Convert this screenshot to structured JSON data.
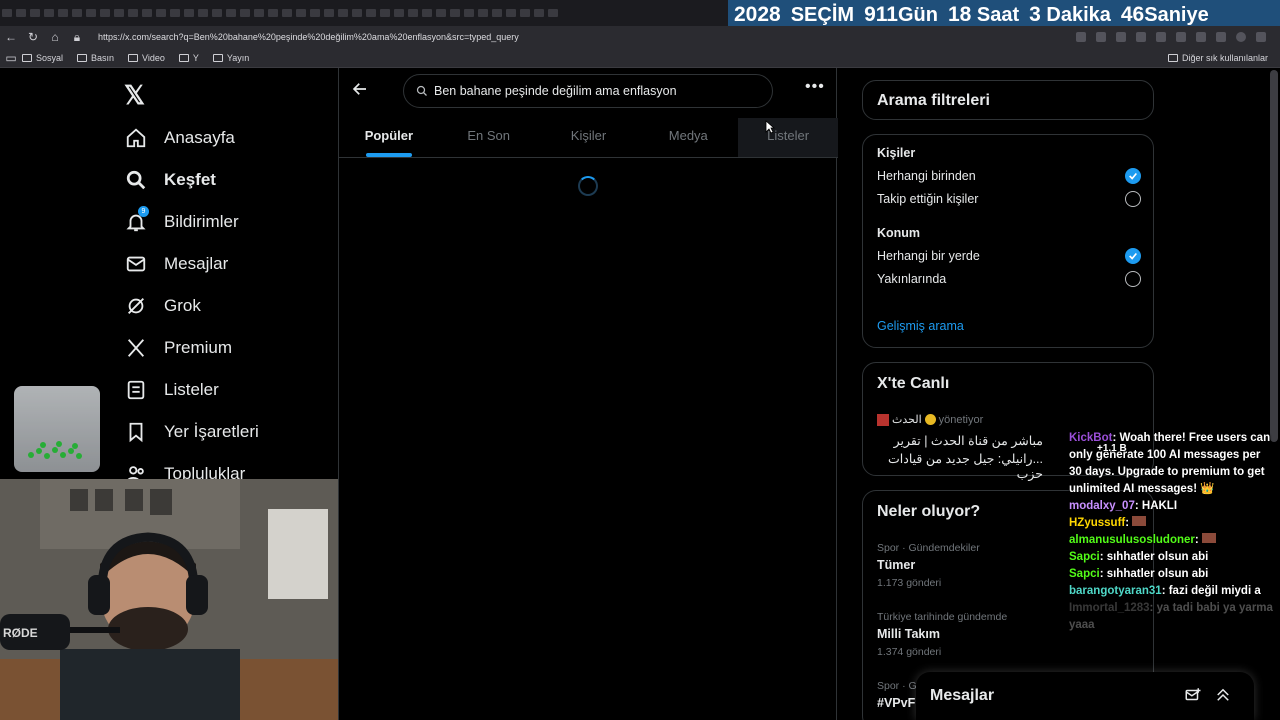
{
  "browser": {
    "url": "https://x.com/search?q=Ben%20bahane%20peşinde%20değilim%20ama%20enflasyon&src=typed_query",
    "bookmarks": [
      "Sosyal",
      "Basın",
      "Video",
      "Y",
      "Yayın"
    ],
    "other_bookmarks": "Diğer sık kullanılanlar"
  },
  "countdown": {
    "year": "2028",
    "label": "SEÇİM",
    "days_num": "911",
    "days_label": "Gün",
    "hours_num": "18",
    "hours_label": "Saat",
    "minutes_num": "3",
    "minutes_label": "Dakika",
    "seconds_num": "46",
    "seconds_label": "Saniye"
  },
  "nav": {
    "items": [
      {
        "label": "Anasayfa",
        "icon": "home-icon"
      },
      {
        "label": "Keşfet",
        "icon": "search-icon"
      },
      {
        "label": "Bildirimler",
        "icon": "bell-icon"
      },
      {
        "label": "Mesajlar",
        "icon": "mail-icon"
      },
      {
        "label": "Grok",
        "icon": "grok-icon"
      },
      {
        "label": "Premium",
        "icon": "x-icon"
      },
      {
        "label": "Listeler",
        "icon": "list-icon"
      },
      {
        "label": "Yer İşaretleri",
        "icon": "bookmark-icon"
      },
      {
        "label": "Topluluklar",
        "icon": "people-icon"
      }
    ],
    "notif_count": "9"
  },
  "search": {
    "query": "Ben bahane peşinde değilim ama enflasyon",
    "tabs": [
      "Popüler",
      "En Son",
      "Kişiler",
      "Medya",
      "Listeler"
    ]
  },
  "filters": {
    "title": "Arama filtreleri",
    "people_heading": "Kişiler",
    "people_any": "Herhangi birinden",
    "people_follow": "Takip ettiğin kişiler",
    "location_heading": "Konum",
    "location_any": "Herhangi bir yerde",
    "location_near": "Yakınlarında",
    "advanced": "Gelişmiş arama"
  },
  "live": {
    "title": "X'te Canlı",
    "host": "الحدث",
    "managing": "yönetiyor",
    "line1": "مباشر من قناة الحدث | تقرير",
    "line2": "...رانيلي: جيل جديد من قيادات حزب"
  },
  "trends": {
    "title": "Neler oluyor?",
    "items": [
      {
        "meta": "Spor · Gündemdekiler",
        "name": "Tümer",
        "count": "1.173 gönderi"
      },
      {
        "meta": "Türkiye tarihinde gündemde",
        "name": "Milli Takım",
        "count": "1.374 gönderi"
      },
      {
        "meta": "Spor · Gü",
        "name": "#VPvF",
        "count": ""
      }
    ]
  },
  "messages_drawer": "Mesajlar",
  "chat": [
    {
      "user": "KickBot",
      "text": "Woah there! Free users can only generate 100 AI messages per 30 days. Upgrade to premium to get unlimited AI messages! 👑",
      "badge": "+1.1 B"
    },
    {
      "user": "modalxy_07",
      "text": "HAKLI"
    },
    {
      "user": "HZyussuff",
      "text": ""
    },
    {
      "user": "almanusulusosludoner",
      "text": ""
    },
    {
      "user": "Sapci",
      "text": "sıhhatler olsun abi"
    },
    {
      "user": "Sapci",
      "text": "sıhhatler olsun abi"
    },
    {
      "user": "barangotyaran31",
      "text": "fazi değil miydi a"
    },
    {
      "user": "Immortal_1283",
      "text": "ya tadi babi ya yarma yaaa"
    }
  ]
}
